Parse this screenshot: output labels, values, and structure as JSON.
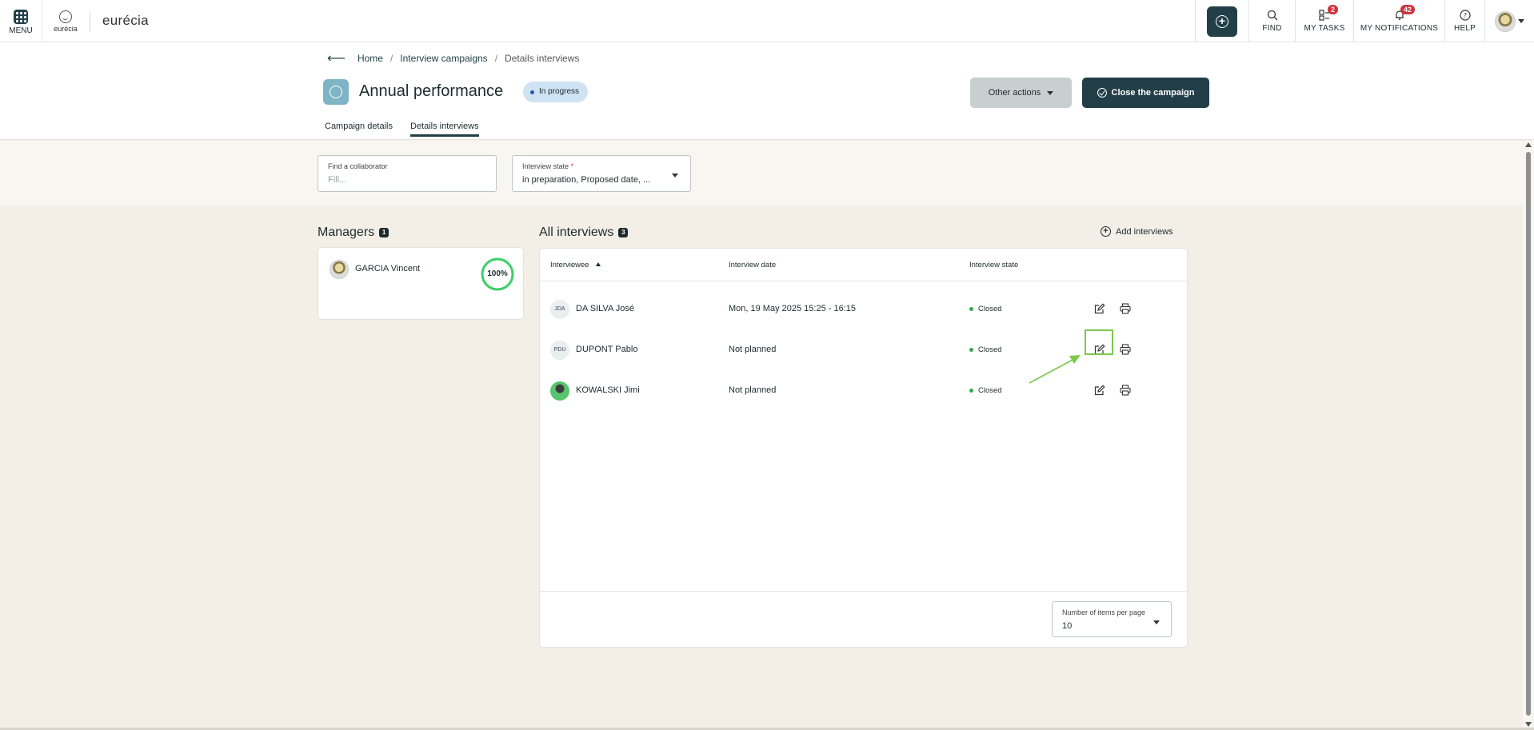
{
  "topbar": {
    "menu_label": "MENU",
    "logo_small_text": "eurécia",
    "brand": "eurécia",
    "find_label": "FIND",
    "tasks_label": "MY TASKS",
    "tasks_count": "2",
    "notifications_label": "MY NOTIFICATIONS",
    "notifications_count": "42",
    "help_label": "HELP"
  },
  "breadcrumb": {
    "home": "Home",
    "campaigns": "Interview campaigns",
    "current": "Details interviews"
  },
  "header": {
    "title": "Annual performance",
    "status": "In progress",
    "other_actions": "Other actions",
    "close_campaign": "Close the campaign"
  },
  "tabs": [
    {
      "label": "Campaign details",
      "active": false
    },
    {
      "label": "Details interviews",
      "active": true
    }
  ],
  "filters": {
    "collaborator_label": "Find a collaborator",
    "collaborator_placeholder": "Fill...",
    "state_label": "Interview state",
    "state_required": "*",
    "state_value": "in preparation, Proposed date, ..."
  },
  "managers": {
    "title": "Managers",
    "count": "1",
    "items": [
      {
        "name": "GARCIA Vincent",
        "progress_label": "100%",
        "progress": 1.0
      }
    ]
  },
  "interviews": {
    "title": "All interviews",
    "count": "3",
    "add_label": "Add interviews",
    "columns": [
      "Interviewee",
      "Interview date",
      "Interview state"
    ],
    "rows": [
      {
        "initials": "JDA",
        "name": "DA SILVA José",
        "date": "Mon, 19 May 2025 15:25 - 16:15",
        "state": "Closed"
      },
      {
        "initials": "PDU",
        "name": "DUPONT Pablo",
        "date": "Not planned",
        "state": "Closed"
      },
      {
        "initials": "",
        "name": "KOWALSKI Jimi",
        "date": "Not planned",
        "state": "Closed"
      }
    ],
    "per_page_label": "Number of items per page",
    "per_page_value": "10"
  },
  "colors": {
    "primary": "#223f48",
    "accent_green": "#7bc94a",
    "status_closed": "#2fa84f",
    "badge_red": "#d1323b"
  },
  "icons": [
    "menu-grid-icon",
    "plus-circle-icon",
    "search-icon",
    "tasks-icon",
    "bell-icon",
    "help-icon",
    "back-arrow-icon",
    "edit-icon",
    "print-icon",
    "check-circle-icon"
  ]
}
